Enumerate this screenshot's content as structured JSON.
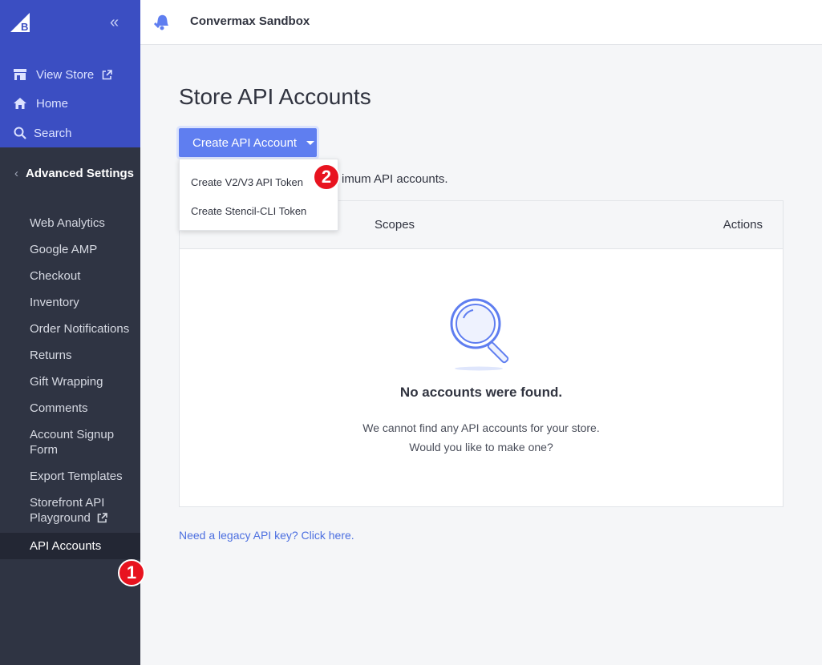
{
  "sidebar": {
    "view_store": "View Store",
    "home": "Home",
    "search": "Search",
    "section": "Advanced Settings",
    "items": [
      {
        "label": "Web Analytics"
      },
      {
        "label": "Google AMP"
      },
      {
        "label": "Checkout"
      },
      {
        "label": "Inventory"
      },
      {
        "label": "Order Notifications"
      },
      {
        "label": "Returns"
      },
      {
        "label": "Gift Wrapping"
      },
      {
        "label": "Comments"
      },
      {
        "label": "Account Signup Form"
      },
      {
        "label": "Export Templates"
      },
      {
        "label": "Storefront API Playground"
      },
      {
        "label": "API Accounts"
      }
    ]
  },
  "topbar": {
    "store_name": "Convermax Sandbox"
  },
  "main": {
    "title": "Store API Accounts",
    "create_button": "Create API Account",
    "info_text": "imum API accounts.",
    "table": {
      "col_scopes": "Scopes",
      "col_actions": "Actions"
    },
    "empty": {
      "title": "No accounts were found.",
      "line1": "We cannot find any API accounts for your store.",
      "line2": "Would you like to make one?"
    },
    "legacy_link": "Need a legacy API key? Click here."
  },
  "dropdown": {
    "items": [
      "Create V2/V3 API Token",
      "Create Stencil-CLI Token"
    ]
  },
  "badges": [
    "1",
    "2"
  ],
  "colors": {
    "sidebar_top": "#3b4ec2",
    "sidebar_bg": "#2f3443",
    "accent": "#5f7ef0",
    "badge": "#e8131f"
  }
}
